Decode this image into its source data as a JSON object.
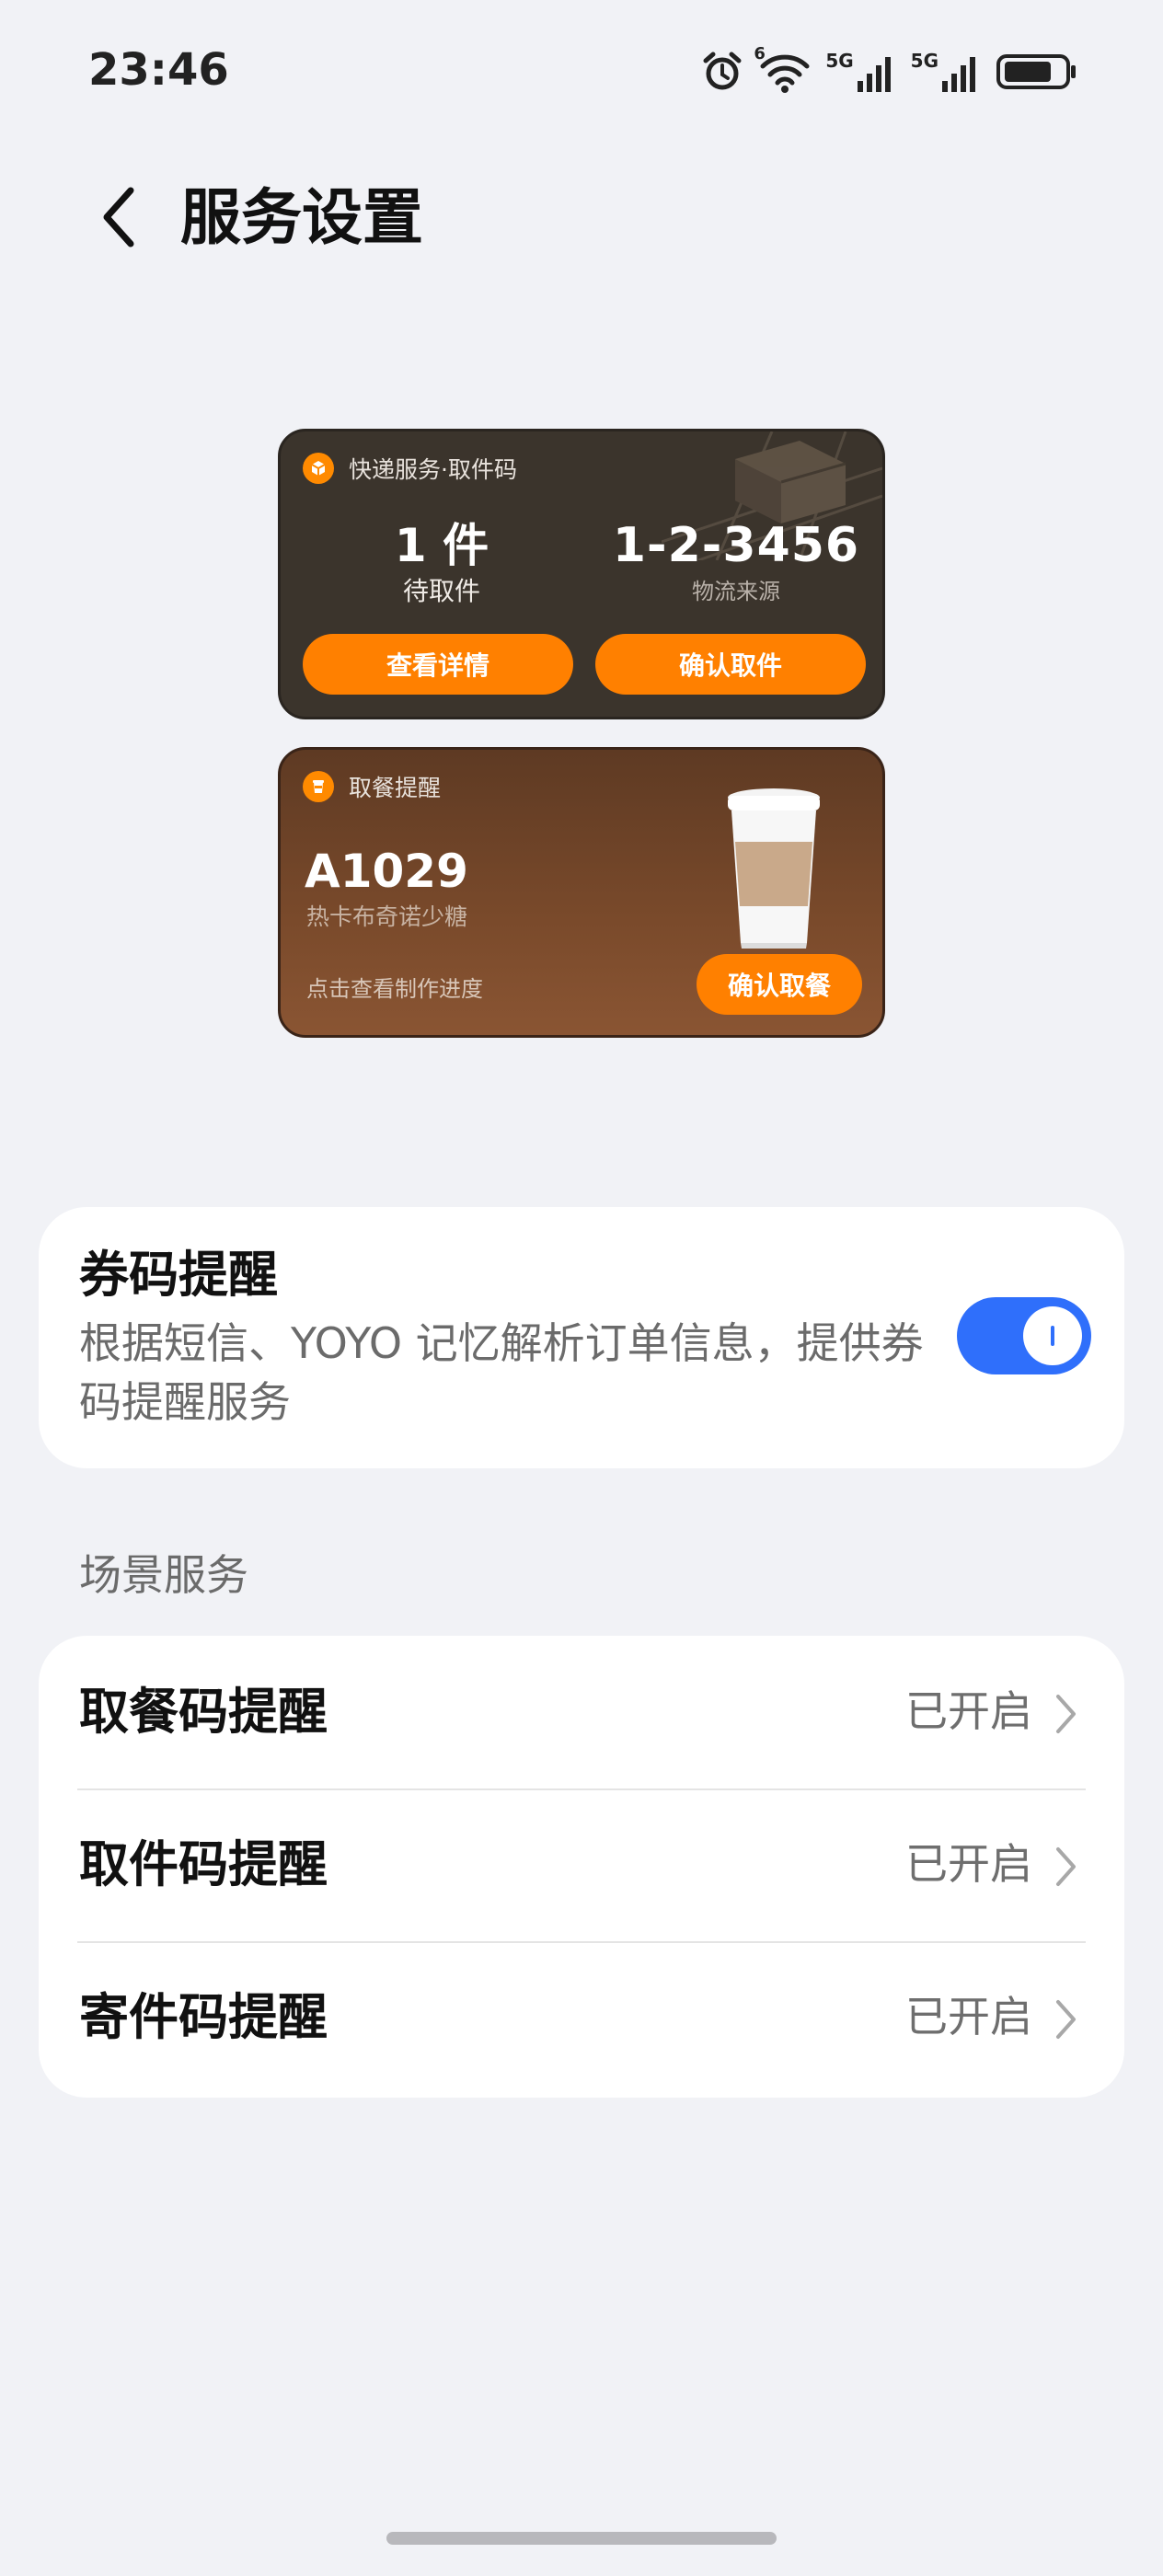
{
  "status_bar": {
    "time": "23:46",
    "icons": [
      "alarm-icon",
      "wifi-icon",
      "signal-5g-icon",
      "signal-5g-icon",
      "battery-icon"
    ],
    "wifi_badge": "6",
    "net_label_1": "5G",
    "net_label_2": "5G"
  },
  "header": {
    "back_icon": "chevron-left-icon",
    "title": "服务设置"
  },
  "preview": {
    "express": {
      "header": "快递服务·取件码",
      "count": "1 件",
      "count_label": "待取件",
      "code": "1-2-3456",
      "source": "物流来源",
      "btn_details": "查看详情",
      "btn_confirm": "确认取件"
    },
    "meal": {
      "header": "取餐提醒",
      "number": "A1029",
      "item": "热卡布奇诺少糖",
      "link": "点击查看制作进度",
      "btn_confirm": "确认取餐"
    },
    "accent": "#ff8000"
  },
  "coupon_toggle": {
    "title": "券码提醒",
    "description": "根据短信、YOYO 记忆解析订单信息，提供券码提醒服务",
    "enabled": true,
    "color": "#2f6ffb"
  },
  "scene_services": {
    "label": "场景服务",
    "items": [
      {
        "label": "取餐码提醒",
        "status": "已开启"
      },
      {
        "label": "取件码提醒",
        "status": "已开启"
      },
      {
        "label": "寄件码提醒",
        "status": "已开启"
      }
    ]
  }
}
